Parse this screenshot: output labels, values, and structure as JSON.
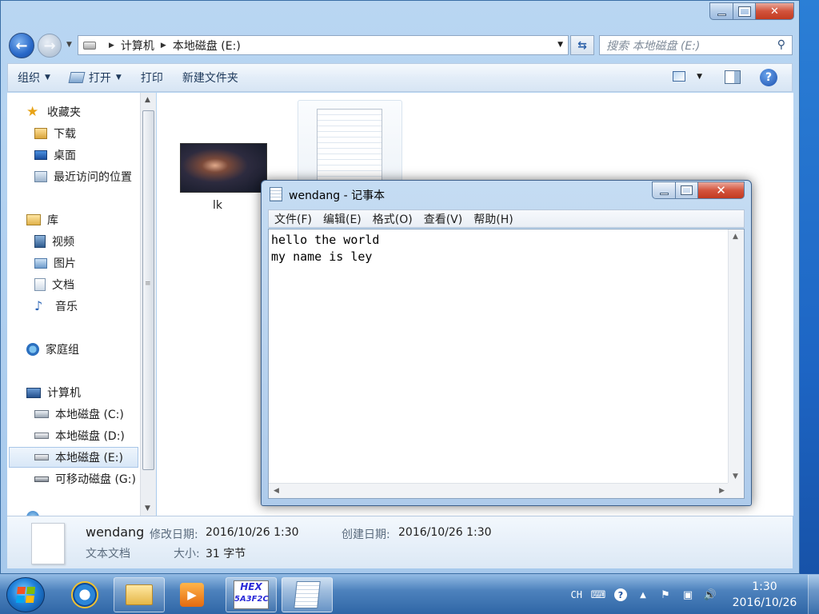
{
  "explorer": {
    "address": {
      "crumbs": [
        "计算机",
        "本地磁盘 (E:)"
      ]
    },
    "search_placeholder": "搜索 本地磁盘 (E:)",
    "toolbar": {
      "organize": "组织",
      "open": "打开",
      "print": "打印",
      "new_folder": "新建文件夹"
    },
    "nav": {
      "favorites": "收藏夹",
      "downloads": "下载",
      "desktop": "桌面",
      "recent": "最近访问的位置",
      "libraries": "库",
      "videos": "视频",
      "pictures": "图片",
      "documents": "文档",
      "music": "音乐",
      "homegroup": "家庭组",
      "computer": "计算机",
      "drive_c": "本地磁盘 (C:)",
      "drive_d": "本地磁盘 (D:)",
      "drive_e": "本地磁盘 (E:)",
      "drive_g": "可移动磁盘 (G:)"
    },
    "files": [
      {
        "name": "lk"
      }
    ],
    "details": {
      "name": "wendang",
      "type": "文本文档",
      "modified_label": "修改日期:",
      "modified_value": "2016/10/26 1:30",
      "created_label": "创建日期:",
      "created_value": "2016/10/26 1:30",
      "size_label": "大小:",
      "size_value": "31 字节"
    }
  },
  "notepad": {
    "title": "wendang - 记事本",
    "menu": [
      "文件(F)",
      "编辑(E)",
      "格式(O)",
      "查看(V)",
      "帮助(H)"
    ],
    "content": "hello the world\nmy name is ley"
  },
  "taskbar": {
    "hex_label_1": "HEX",
    "hex_label_2": "5A3F2C",
    "language": "CH",
    "time": "1:30",
    "date": "2016/10/26"
  }
}
